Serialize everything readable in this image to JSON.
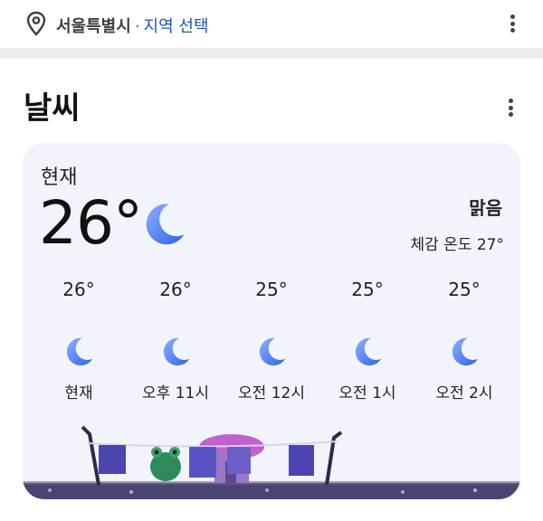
{
  "location_bar": {
    "city": "서울특별시",
    "separator": "·",
    "change_label": "지역 선택",
    "pin_icon": "location-pin-icon",
    "more_icon": "more-vert-icon"
  },
  "section": {
    "title": "날씨",
    "more_icon": "more-vert-icon"
  },
  "current": {
    "label": "현재",
    "temperature": "26°",
    "condition": "맑음",
    "feels_like": "체감 온도 27°",
    "icon": "moon-icon"
  },
  "hourly": [
    {
      "temp": "26°",
      "time": "현재",
      "icon": "moon-icon"
    },
    {
      "temp": "26°",
      "time": "오후 11시",
      "icon": "moon-icon"
    },
    {
      "temp": "25°",
      "time": "오전 12시",
      "icon": "moon-icon"
    },
    {
      "temp": "25°",
      "time": "오전 1시",
      "icon": "moon-icon"
    },
    {
      "temp": "25°",
      "time": "오전 2시",
      "icon": "moon-icon"
    }
  ],
  "colors": {
    "accent_link": "#1a56b8",
    "card_bg": "#f1f5fb",
    "moon": "#4d7ef0"
  }
}
